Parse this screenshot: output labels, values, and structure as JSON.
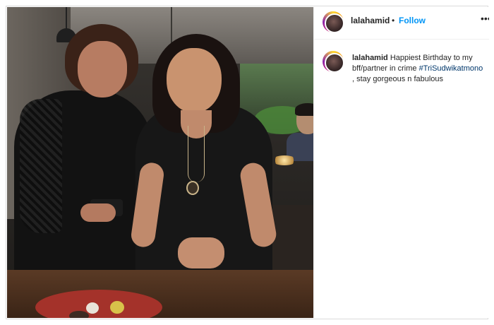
{
  "post": {
    "photo_alt": "Two women posing in a restaurant"
  },
  "header": {
    "username": "lalahamid",
    "separator": "•",
    "follow_label": "Follow",
    "more_icon": "more-options-icon"
  },
  "caption": {
    "username": "lalahamid",
    "text_before": "Happiest Birthday to my bff/partner in crime ",
    "hashtag": "#TriSudwikatmono",
    "text_after": " , stay gorgeous n fabulous"
  },
  "colors": {
    "follow": "#0095f6",
    "hashtag": "#00376b",
    "text": "#262626"
  }
}
